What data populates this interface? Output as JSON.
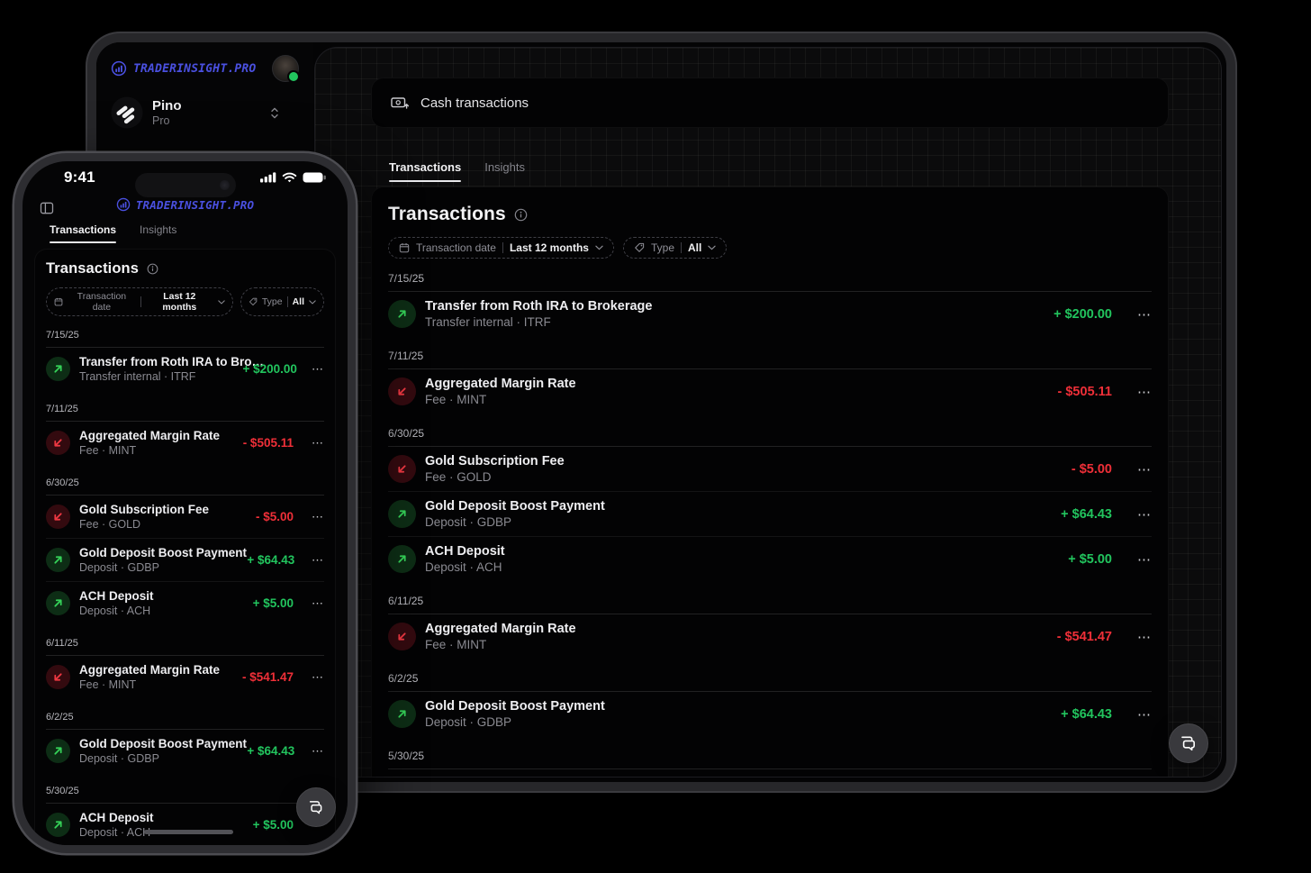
{
  "colors": {
    "accent": "#4a50e0",
    "positive": "#22c55e",
    "negative": "#ef2f38"
  },
  "brand": {
    "name": "TRADERINSIGHT.PRO"
  },
  "sidebar": {
    "workspace_name": "Pino",
    "workspace_plan": "Pro"
  },
  "top_card": {
    "title": "Cash transactions"
  },
  "tabs": {
    "transactions": "Transactions",
    "insights": "Insights"
  },
  "panel": {
    "title": "Transactions",
    "date_filter_label": "Transaction date",
    "date_filter_value": "Last 12 months",
    "type_filter_label": "Type",
    "type_filter_value": "All"
  },
  "phone_status": {
    "time": "9:41"
  },
  "icons": {
    "row_menu": "⋯",
    "brand": "bar-chart-circle",
    "top_card": "banknote-arrow",
    "info": "info-circle",
    "date_chip": "calendar",
    "type_chip": "tag",
    "chip_caret": "chevron-down",
    "workspace_caret": "chevron-up-down",
    "incoming": "arrow-up-right",
    "outgoing": "arrow-down-left",
    "fab": "chat-bubbles",
    "phone_header_left": "panel-left"
  },
  "transactions": {
    "groups": [
      {
        "date": "7/15/25",
        "rows": [
          {
            "title": "Transfer from Roth IRA to Brokerage",
            "title_short": "Transfer from Roth IRA to Bro…",
            "subtitle": "Transfer internal · ITRF",
            "amount": "+ $200.00",
            "direction": "in"
          }
        ]
      },
      {
        "date": "7/11/25",
        "rows": [
          {
            "title": "Aggregated Margin Rate",
            "subtitle": "Fee · MINT",
            "amount": "- $505.11",
            "direction": "out"
          }
        ]
      },
      {
        "date": "6/30/25",
        "rows": [
          {
            "title": "Gold Subscription Fee",
            "subtitle": "Fee · GOLD",
            "amount": "- $5.00",
            "direction": "out"
          },
          {
            "title": "Gold Deposit Boost Payment",
            "subtitle": "Deposit · GDBP",
            "amount": "+ $64.43",
            "direction": "in"
          },
          {
            "title": "ACH Deposit",
            "subtitle": "Deposit · ACH",
            "amount": "+ $5.00",
            "direction": "in"
          }
        ]
      },
      {
        "date": "6/11/25",
        "rows": [
          {
            "title": "Aggregated Margin Rate",
            "subtitle": "Fee · MINT",
            "amount": "- $541.47",
            "direction": "out"
          }
        ]
      },
      {
        "date": "6/2/25",
        "rows": [
          {
            "title": "Gold Deposit Boost Payment",
            "subtitle": "Deposit · GDBP",
            "amount": "+ $64.43",
            "direction": "in"
          }
        ]
      },
      {
        "date": "5/30/25",
        "rows": [
          {
            "title": "ACH Deposit",
            "subtitle": "Deposit · ACH",
            "amount": "+ $5.00",
            "direction": "in"
          }
        ]
      }
    ]
  }
}
